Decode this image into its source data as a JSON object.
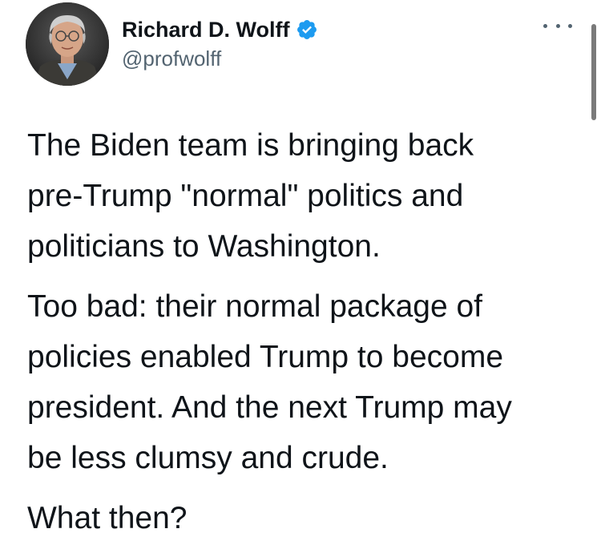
{
  "author": {
    "display_name": "Richard D. Wolff",
    "handle": "@profwolff",
    "verified_icon": "verified-badge-icon",
    "avatar_icon": "profile-photo-avatar"
  },
  "menu": {
    "more_icon": "more-options-icon"
  },
  "tweet": {
    "paragraphs": [
      "The Biden team is bringing back\npre-Trump \"normal\" politics and\npoliticians to Washington.",
      "Too bad: their normal package of\npolicies enabled Trump to become\npresident. And the next Trump may\nbe less clumsy and crude.",
      "What then?"
    ]
  },
  "colors": {
    "text": "#0f1419",
    "secondary_text": "#536471",
    "verified_blue": "#1d9bf0",
    "background": "#ffffff"
  }
}
